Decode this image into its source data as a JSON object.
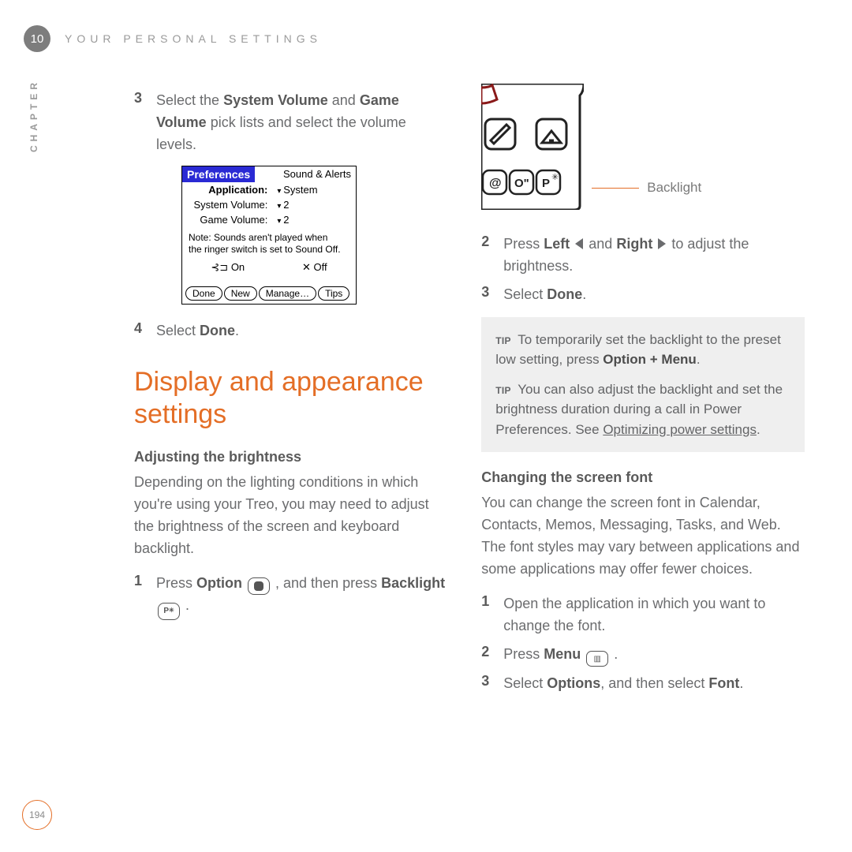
{
  "header": {
    "chapter_num": "10",
    "title": "YOUR PERSONAL SETTINGS",
    "side_label": "CHAPTER"
  },
  "page_number": "194",
  "left": {
    "step3_a": "Select the ",
    "step3_b": "System Volume",
    "step3_c": " and ",
    "step3_d": "Game Volume",
    "step3_e": " pick lists and select the volume levels.",
    "palm": {
      "pref": "Preferences",
      "section": "Sound & Alerts",
      "app_lbl": "Application:",
      "app_val": "System",
      "sys_lbl": "System Volume:",
      "sys_val": "2",
      "game_lbl": "Game Volume:",
      "game_val": "2",
      "note1": "Note: Sounds aren't played when",
      "note2": "the ringer switch is set to Sound Off.",
      "on": "On",
      "off": "Off",
      "btn_done": "Done",
      "btn_new": "New",
      "btn_manage": "Manage…",
      "btn_tips": "Tips"
    },
    "step4_a": "Select ",
    "step4_b": "Done",
    "step4_c": ".",
    "h2": "Display and appearance settings",
    "h3_brightness": "Adjusting the brightness",
    "brightness_para": "Depending on the lighting conditions in which you're using your Treo, you may need to adjust the brightness of the screen and keyboard backlight.",
    "b_step1_a": "Press ",
    "b_step1_b": "Option",
    "b_step1_c": " , and then press ",
    "b_step1_d": "Backlight",
    "b_step1_e": " ."
  },
  "right": {
    "callout": "Backlight",
    "step2_a": "Press ",
    "step2_b": "Left",
    "step2_c": " and ",
    "step2_d": "Right",
    "step2_e": " to adjust the brightness.",
    "step3_a": "Select ",
    "step3_b": "Done",
    "step3_c": ".",
    "tip1_a": "To temporarily set the backlight to the preset low setting, press ",
    "tip1_b": "Option + Menu",
    "tip1_c": ".",
    "tip2_a": "You can also adjust the backlight and set the brightness duration during a call in Power Preferences. See ",
    "tip2_link": "Optimizing power settings",
    "tip2_c": ".",
    "h3_font": "Changing the screen font",
    "font_para": "You can change the screen font in Calendar, Contacts, Memos, Messaging, Tasks, and Web. The font styles may vary between applications and some applications may offer fewer choices.",
    "f_step1": "Open the application in which you want to change the font.",
    "f_step2_a": "Press ",
    "f_step2_b": "Menu",
    "f_step2_c": " .",
    "f_step3_a": "Select ",
    "f_step3_b": "Options",
    "f_step3_c": ", and then select ",
    "f_step3_d": "Font",
    "f_step3_e": ".",
    "tip_label": "TIP"
  }
}
